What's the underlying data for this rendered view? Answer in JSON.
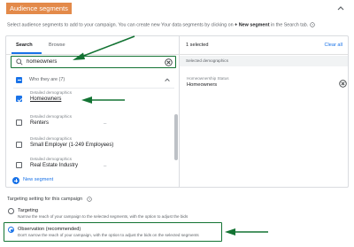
{
  "section": {
    "title": "Audience segments"
  },
  "intro": {
    "text_before": "Select audience segments to add to your campaign. You can create new Your data segments by clicking on",
    "bold": "+ New segment",
    "text_after": "in the Search tab."
  },
  "tabs": [
    {
      "label": "Search",
      "active": true
    },
    {
      "label": "Browse",
      "active": false
    }
  ],
  "search": {
    "value": "homeowners",
    "placeholder": ""
  },
  "group": {
    "label": "Who they are (7)"
  },
  "results": [
    {
      "category": "Detailed demographics",
      "name": "Homeowners",
      "checked": true
    },
    {
      "category": "Detailed demographics",
      "name": "Renters",
      "checked": false
    },
    {
      "category": "Detailed demographics",
      "name": "Small Employer (1-249 Employees)",
      "checked": false
    },
    {
      "category": "Detailed demographics",
      "name": "Real Estate Industry",
      "checked": false
    }
  ],
  "new_segment": {
    "label": "New segment"
  },
  "selected_panel": {
    "count_label": "1 selected",
    "clear_all": "Clear all",
    "group": "Selected demographics",
    "items": [
      {
        "category": "Homeownership Status",
        "name": "Homeowners"
      }
    ]
  },
  "targeting": {
    "title": "Targeting setting for this campaign",
    "options": [
      {
        "title": "Targeting",
        "desc": "Narrow the reach of your campaign to the selected segments, with the option to adjust the bids",
        "selected": false
      },
      {
        "title": "Observation (recommended)",
        "desc": "Don't narrow the reach of your campaign, with the option to adjust the bids on the selected segments",
        "selected": true
      }
    ]
  },
  "colors": {
    "accent": "#1a73e8",
    "annotation": "#137333",
    "header_highlight": "#e38a4a"
  },
  "icons": [
    "chevron-up-icon",
    "search-icon",
    "clear-search-icon",
    "remove-icon",
    "plus-icon",
    "help-icon"
  ]
}
